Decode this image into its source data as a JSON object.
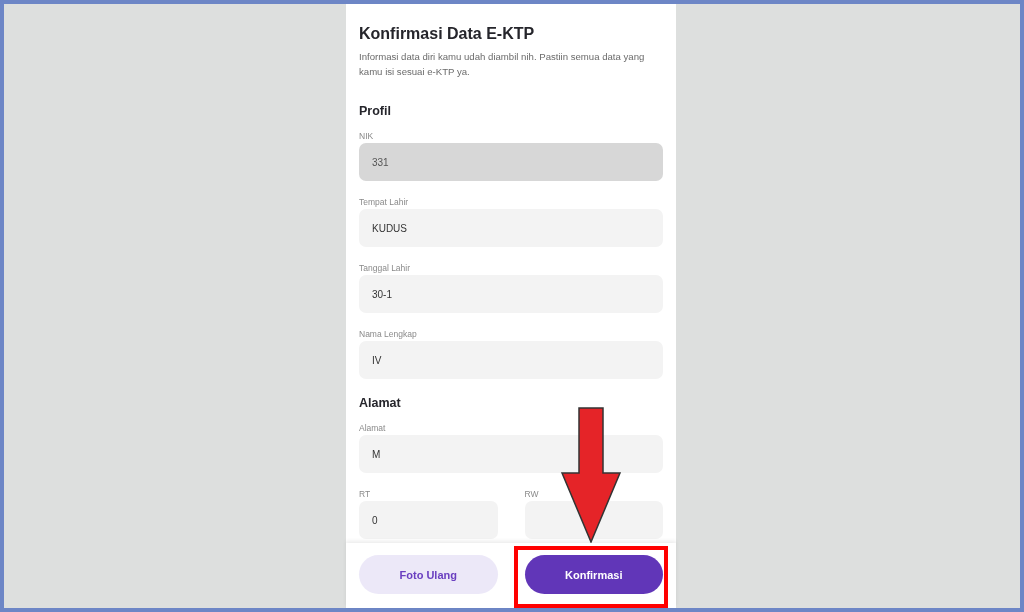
{
  "screen": {
    "title": "Konfirmasi Data E-KTP",
    "description": "Informasi data diri kamu udah diambil nih. Pastiin semua data yang kamu isi sesuai e-KTP ya."
  },
  "sections": [
    {
      "heading": "Profil",
      "fields": [
        {
          "label": "NIK",
          "value": "331",
          "disabled": true
        },
        {
          "label": "Tempat Lahir",
          "value": "KUDUS",
          "disabled": false
        },
        {
          "label": "Tanggal Lahir",
          "value": "30-1",
          "disabled": false
        },
        {
          "label": "Nama Lengkap",
          "value": "IV",
          "disabled": false
        }
      ]
    },
    {
      "heading": "Alamat",
      "fields": [
        {
          "label": "Alamat",
          "value": "M",
          "disabled": false
        }
      ],
      "pair": [
        {
          "label": "RT",
          "value": "0",
          "disabled": false
        },
        {
          "label": "RW",
          "disabled": false
        }
      ]
    }
  ],
  "buttons": [
    {
      "label": "Foto Ulang",
      "kind": "secondary",
      "highlighted": false,
      "arrow": false
    },
    {
      "label": "Konfirmasi",
      "kind": "primary",
      "highlighted": true,
      "arrow": true
    }
  ]
}
